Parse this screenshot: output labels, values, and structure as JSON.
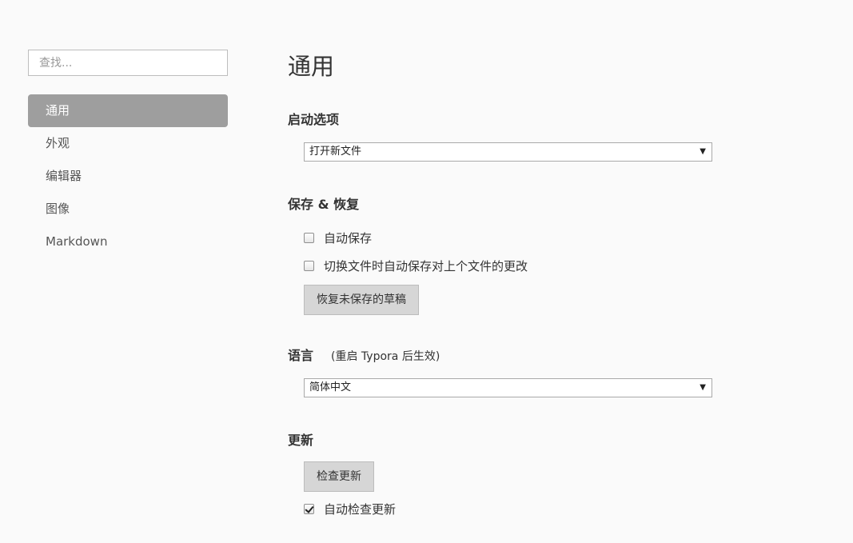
{
  "search": {
    "placeholder": "查找..."
  },
  "sidebar": {
    "items": [
      {
        "label": "通用",
        "active": true
      },
      {
        "label": "外观"
      },
      {
        "label": "编辑器"
      },
      {
        "label": "图像"
      },
      {
        "label": "Markdown"
      }
    ]
  },
  "main": {
    "title": "通用",
    "startup": {
      "heading": "启动选项",
      "selected": "打开新文件"
    },
    "save_restore": {
      "heading": "保存 & 恢复",
      "auto_save": {
        "label": "自动保存",
        "checked": false
      },
      "save_on_switch": {
        "label": "切换文件时自动保存对上个文件的更改",
        "checked": false
      },
      "restore_button": "恢复未保存的草稿"
    },
    "language": {
      "heading": "语言",
      "hint": "(重启 Typora 后生效)",
      "selected": "简体中文"
    },
    "update": {
      "heading": "更新",
      "check_button": "检查更新",
      "auto_check": {
        "label": "自动检查更新",
        "checked": true
      }
    }
  },
  "colors": {
    "background": "#fafafa",
    "active_nav": "#9e9e9e",
    "button": "#d6d6d6"
  }
}
